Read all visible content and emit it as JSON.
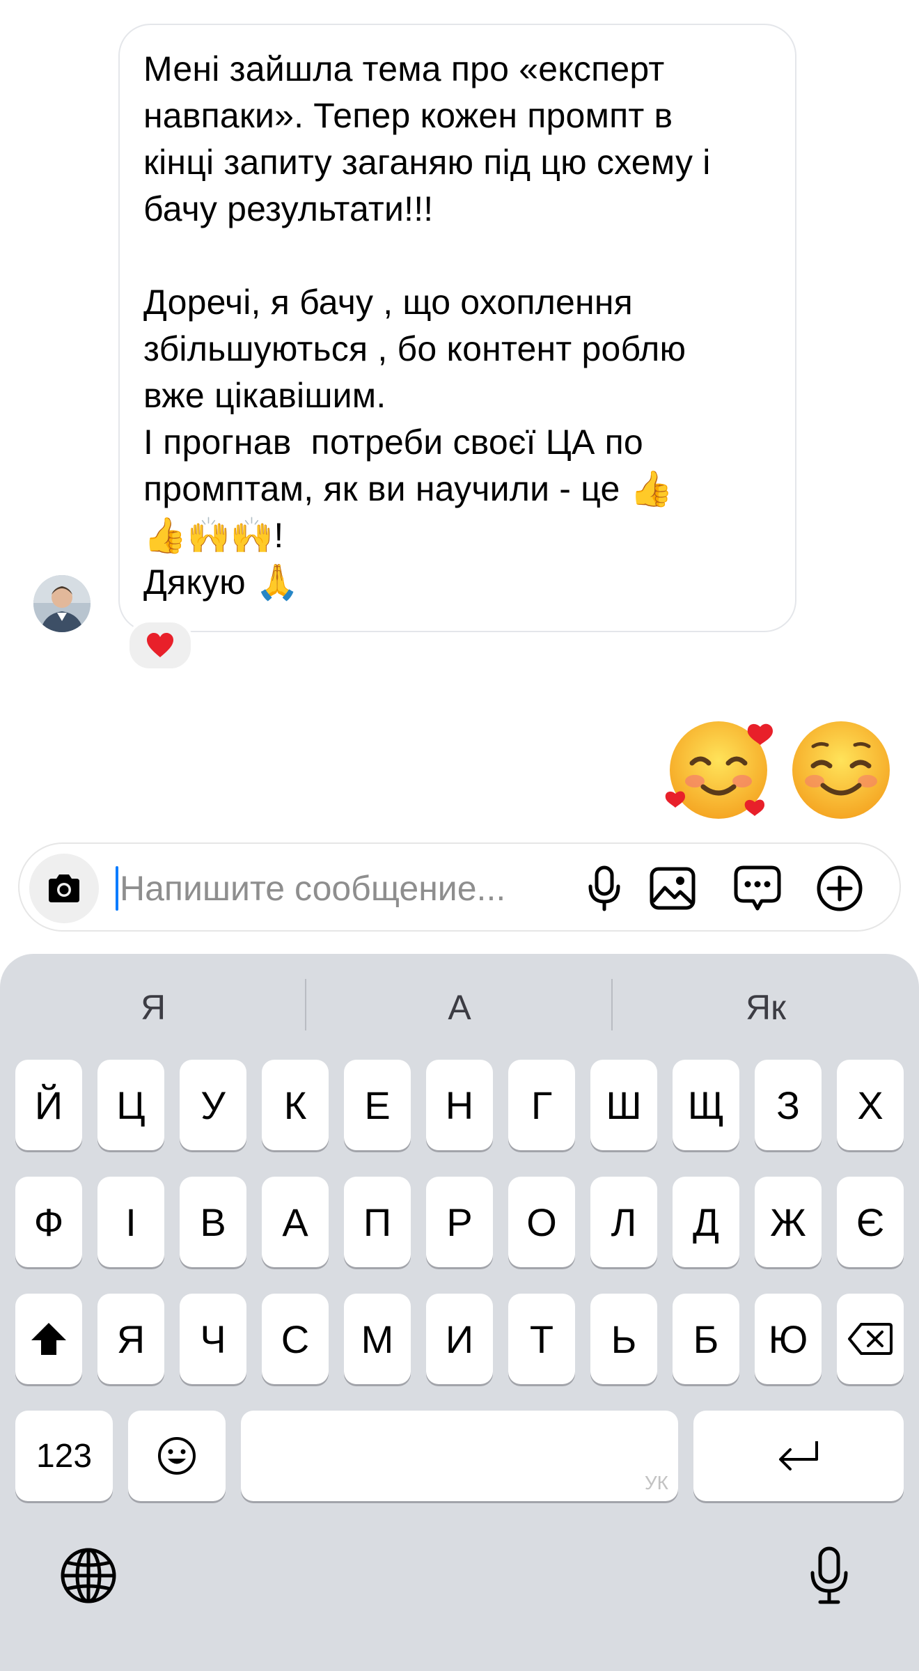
{
  "message": {
    "text": "Мені зайшла тема про «експерт\nнавпаки». Тепер кожен промпт в\nкінці запиту заганяю під цю схему і\nбачу результати!!!\n\nДоречі, я бачу , що охоплення\nзбільшуються , бо контент роблю\nвже цікавішим.\nІ прогнав  потреби своєї ЦА по\nпромптам, як ви научили - це 👍\n👍🙌🙌!\nДякую 🙏",
    "reaction": "❤️"
  },
  "sent_emojis": [
    "🥰",
    "☺️"
  ],
  "composer": {
    "placeholder": "Напишите сообщение...",
    "icons": [
      "camera-icon",
      "microphone-icon",
      "gallery-icon",
      "sticker-icon",
      "plus-icon"
    ]
  },
  "keyboard": {
    "suggestions": [
      "Я",
      "А",
      "Як"
    ],
    "row1": [
      "Й",
      "Ц",
      "У",
      "К",
      "Е",
      "Н",
      "Г",
      "Ш",
      "Щ",
      "З",
      "Х"
    ],
    "row2": [
      "Ф",
      "І",
      "В",
      "А",
      "П",
      "Р",
      "О",
      "Л",
      "Д",
      "Ж",
      "Є"
    ],
    "row3": [
      "Я",
      "Ч",
      "С",
      "М",
      "И",
      "Т",
      "Ь",
      "Б",
      "Ю"
    ],
    "numbers_label": "123",
    "space_language": "УК",
    "shift_icon": "shift-icon",
    "backspace_icon": "backspace-icon",
    "emoji_icon": "emoji-icon",
    "return_icon": "return-icon",
    "globe_icon": "globe-icon",
    "dictation_icon": "microphone-icon"
  }
}
